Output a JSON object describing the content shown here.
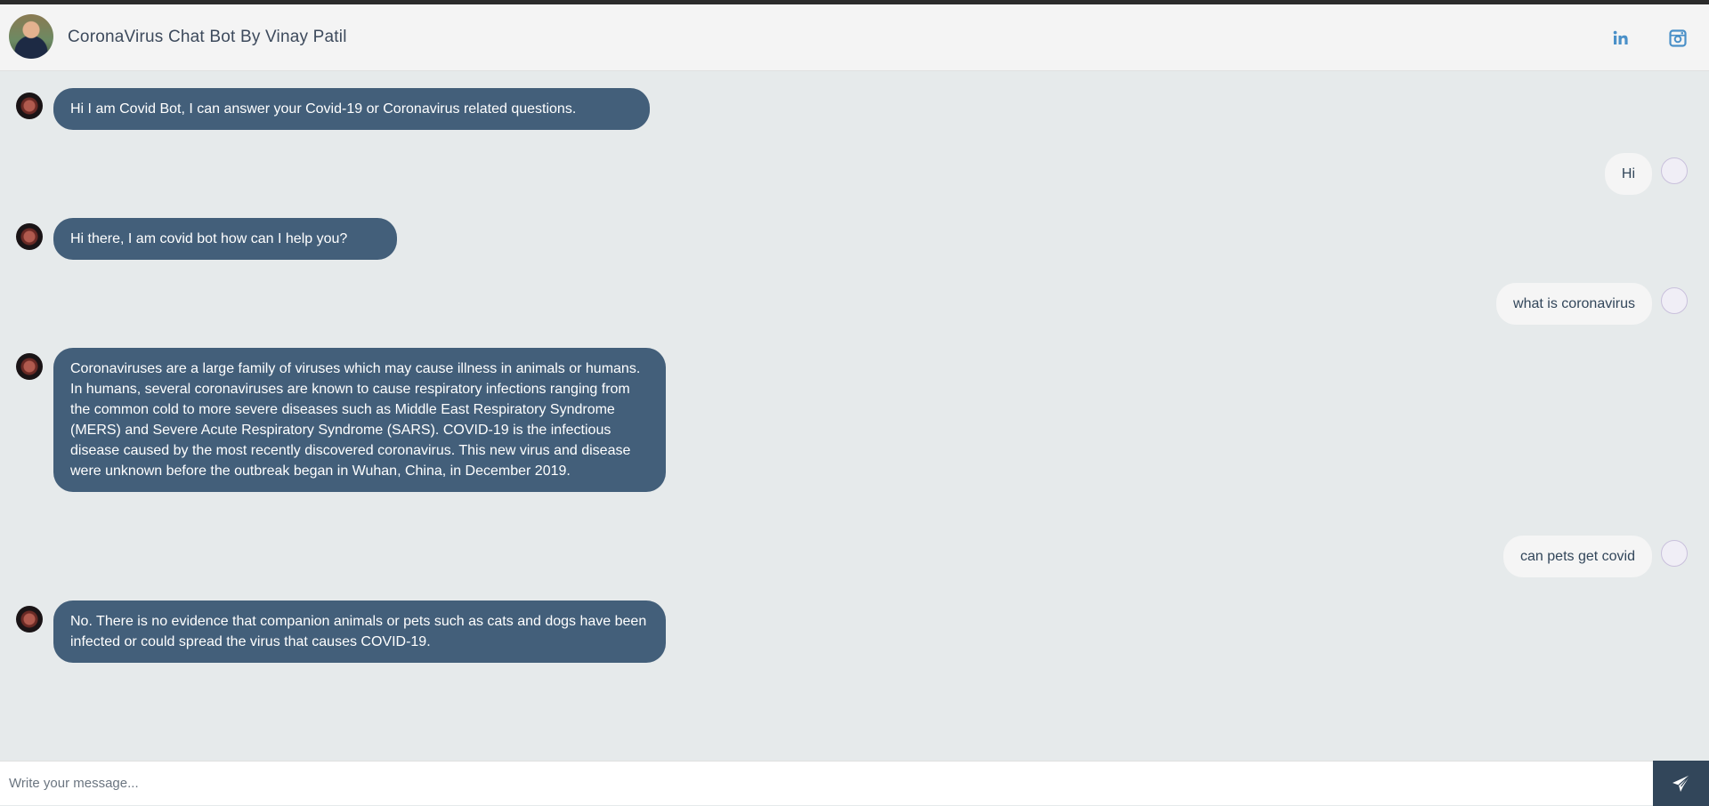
{
  "header": {
    "title": "CoronaVirus Chat Bot By Vinay Patil",
    "social": [
      {
        "name": "linkedin",
        "icon": "linkedin-icon"
      },
      {
        "name": "instagram",
        "icon": "instagram-icon"
      }
    ]
  },
  "messages": [
    {
      "sender": "bot",
      "text": "Hi I am Covid Bot, I can answer your Covid-19 or Coronavirus related questions."
    },
    {
      "sender": "user",
      "text": "Hi"
    },
    {
      "sender": "bot",
      "text": "Hi there, I am covid bot how can I help you?"
    },
    {
      "sender": "user",
      "text": "what is coronavirus"
    },
    {
      "sender": "bot",
      "text": "Coronaviruses are a large family of viruses which may cause illness in animals or humans. In humans, several coronaviruses are known to cause respiratory infections ranging from the common cold to more severe diseases such as Middle East Respiratory Syndrome (MERS) and Severe Acute Respiratory Syndrome (SARS). COVID-19 is the infectious disease caused by the most recently discovered coronavirus. This new virus and disease were unknown before the outbreak began in Wuhan, China, in December 2019."
    },
    {
      "sender": "user",
      "text": "can pets get covid"
    },
    {
      "sender": "bot",
      "text": "No. There is no evidence that companion animals or pets such as cats and dogs have been infected or could spread the virus that causes COVID-19."
    }
  ],
  "composer": {
    "placeholder": "Write your message...",
    "value": ""
  },
  "colors": {
    "bot_bubble": "#435f7a",
    "user_bubble": "#f5f5f5",
    "background": "#e6eaeb",
    "send_button": "#32465a",
    "social_icon": "#4a90c8"
  }
}
